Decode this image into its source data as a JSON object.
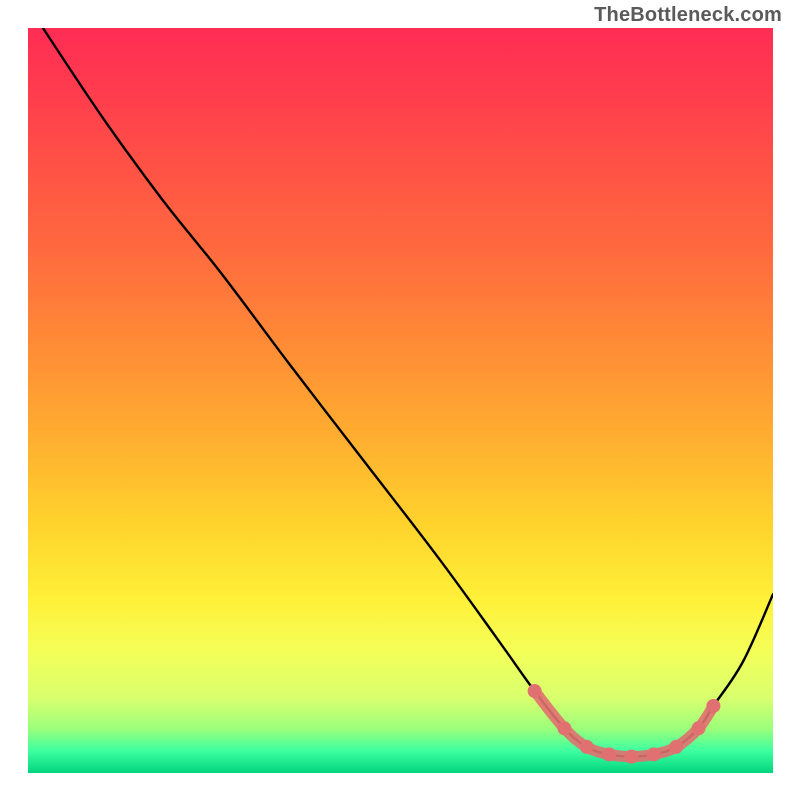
{
  "watermark": "TheBottleneck.com",
  "chart_data": {
    "type": "line",
    "title": "",
    "xlabel": "",
    "ylabel": "",
    "xlim": [
      0,
      1
    ],
    "ylim": [
      0,
      1
    ],
    "series": [
      {
        "name": "curve",
        "color": "#000000",
        "x": [
          0.02,
          0.1,
          0.18,
          0.26,
          0.35,
          0.45,
          0.55,
          0.63,
          0.68,
          0.72,
          0.75,
          0.78,
          0.81,
          0.84,
          0.87,
          0.9,
          0.92,
          0.96,
          1.0
        ],
        "values": [
          1.0,
          0.88,
          0.77,
          0.67,
          0.55,
          0.42,
          0.29,
          0.18,
          0.11,
          0.06,
          0.035,
          0.025,
          0.022,
          0.025,
          0.035,
          0.06,
          0.09,
          0.15,
          0.24
        ]
      }
    ],
    "markers": {
      "color": "#e17070",
      "radius": 7,
      "x": [
        0.68,
        0.72,
        0.75,
        0.78,
        0.81,
        0.84,
        0.87,
        0.9,
        0.92
      ],
      "values": [
        0.11,
        0.06,
        0.035,
        0.025,
        0.022,
        0.025,
        0.035,
        0.06,
        0.09
      ]
    }
  }
}
